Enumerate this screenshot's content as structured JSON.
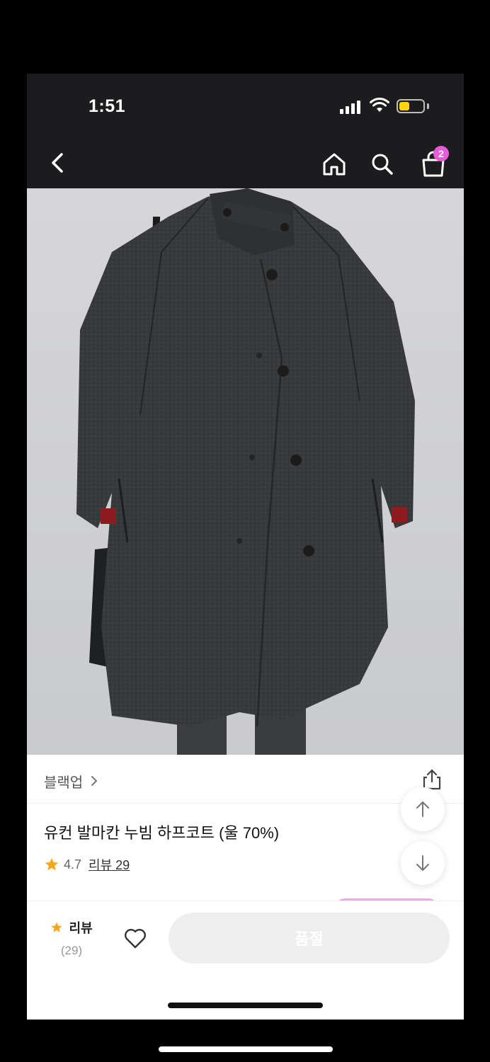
{
  "status_bar": {
    "time": "1:51"
  },
  "header": {
    "back_icon": "chevron-left-icon",
    "home_icon": "home-icon",
    "search_icon": "search-icon",
    "cart_icon": "shopping-bag-icon",
    "cart_badge": "2",
    "badge_color": "#e85bd6"
  },
  "product": {
    "image_subject": "charcoal wool half coat",
    "brand": "블랙업",
    "title": "유컨 발마칸 누빔 하프코트 (울 70%)",
    "rating": "4.7",
    "review_link": "리뷰 29",
    "star_color": "#f5a623"
  },
  "actions": {
    "share_icon": "share-icon",
    "scroll_top_icon": "arrow-up-icon",
    "scroll_bottom_icon": "arrow-down-icon"
  },
  "bottom_bar": {
    "review_label": "리뷰",
    "review_count": "(29)",
    "wish_icon": "heart-icon",
    "primary_button": "품절"
  }
}
